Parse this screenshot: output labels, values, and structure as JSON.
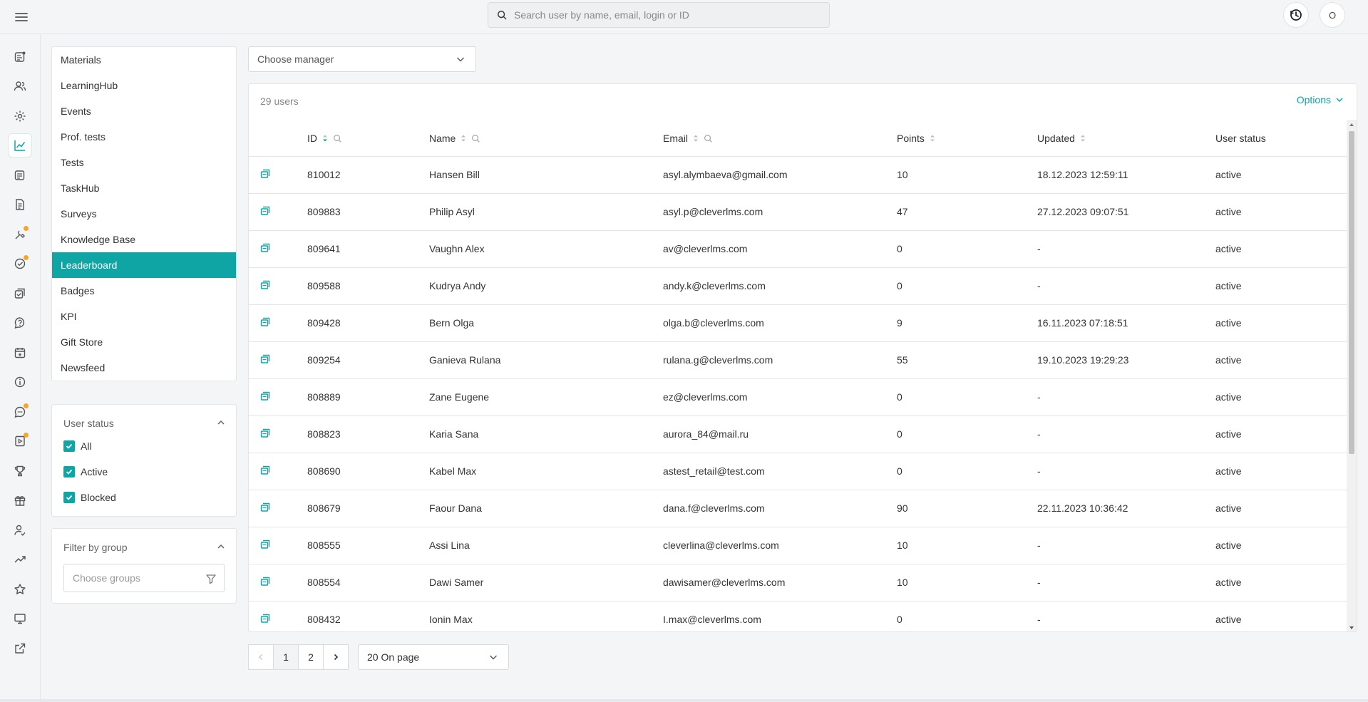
{
  "topbar": {
    "search_placeholder": "Search user by name, email, login or ID",
    "avatar_initial": "O"
  },
  "side_menu": {
    "items": [
      {
        "label": "Materials"
      },
      {
        "label": "LearningHub"
      },
      {
        "label": "Events"
      },
      {
        "label": "Prof. tests"
      },
      {
        "label": "Tests"
      },
      {
        "label": "TaskHub"
      },
      {
        "label": "Surveys"
      },
      {
        "label": "Knowledge Base"
      },
      {
        "label": "Leaderboard",
        "active": true
      },
      {
        "label": "Badges"
      },
      {
        "label": "KPI"
      },
      {
        "label": "Gift Store"
      },
      {
        "label": "Newsfeed"
      }
    ]
  },
  "user_status_filter": {
    "title": "User status",
    "options": [
      {
        "label": "All",
        "checked": true
      },
      {
        "label": "Active",
        "checked": true
      },
      {
        "label": "Blocked",
        "checked": true
      }
    ]
  },
  "group_filter": {
    "title": "Filter by group",
    "placeholder": "Choose groups"
  },
  "manager_select": {
    "placeholder": "Choose manager"
  },
  "table": {
    "count_label": "29 users",
    "options_label": "Options",
    "columns": {
      "id": "ID",
      "name": "Name",
      "email": "Email",
      "points": "Points",
      "updated": "Updated",
      "status": "User status"
    },
    "rows": [
      {
        "id": "810012",
        "name": "Hansen Bill",
        "email": "asyl.alymbaeva@gmail.com",
        "points": "10",
        "updated": "18.12.2023 12:59:11",
        "status": "active"
      },
      {
        "id": "809883",
        "name": "Philip Asyl",
        "email": "asyl.p@cleverlms.com",
        "points": "47",
        "updated": "27.12.2023 09:07:51",
        "status": "active"
      },
      {
        "id": "809641",
        "name": "Vaughn Alex",
        "email": "av@cleverlms.com",
        "points": "0",
        "updated": "-",
        "status": "active"
      },
      {
        "id": "809588",
        "name": "Kudrya Andy",
        "email": "andy.k@cleverlms.com",
        "points": "0",
        "updated": "-",
        "status": "active"
      },
      {
        "id": "809428",
        "name": "Bern Olga",
        "email": "olga.b@cleverlms.com",
        "points": "9",
        "updated": "16.11.2023 07:18:51",
        "status": "active"
      },
      {
        "id": "809254",
        "name": "Ganieva Rulana",
        "email": "rulana.g@cleverlms.com",
        "points": "55",
        "updated": "19.10.2023 19:29:23",
        "status": "active"
      },
      {
        "id": "808889",
        "name": "Zane Eugene",
        "email": "ez@cleverlms.com",
        "points": "0",
        "updated": "-",
        "status": "active"
      },
      {
        "id": "808823",
        "name": "Karia Sana",
        "email": "aurora_84@mail.ru",
        "points": "0",
        "updated": "-",
        "status": "active"
      },
      {
        "id": "808690",
        "name": "Kabel Max",
        "email": "astest_retail@test.com",
        "points": "0",
        "updated": "-",
        "status": "active"
      },
      {
        "id": "808679",
        "name": "Faour Dana",
        "email": "dana.f@cleverlms.com",
        "points": "90",
        "updated": "22.11.2023 10:36:42",
        "status": "active"
      },
      {
        "id": "808555",
        "name": "Assi Lina",
        "email": "cleverlina@cleverlms.com",
        "points": "10",
        "updated": "-",
        "status": "active"
      },
      {
        "id": "808554",
        "name": "Dawi Samer",
        "email": "dawisamer@cleverlms.com",
        "points": "10",
        "updated": "-",
        "status": "active"
      },
      {
        "id": "808432",
        "name": "Ionin Max",
        "email": "I.max@cleverlms.com",
        "points": "0",
        "updated": "-",
        "status": "active"
      }
    ]
  },
  "pagination": {
    "pages": [
      "1",
      "2"
    ],
    "current": "1",
    "per_page_label": "20 On page"
  },
  "colors": {
    "accent": "#0ea5a4",
    "notification_dot": "#f5a623"
  }
}
